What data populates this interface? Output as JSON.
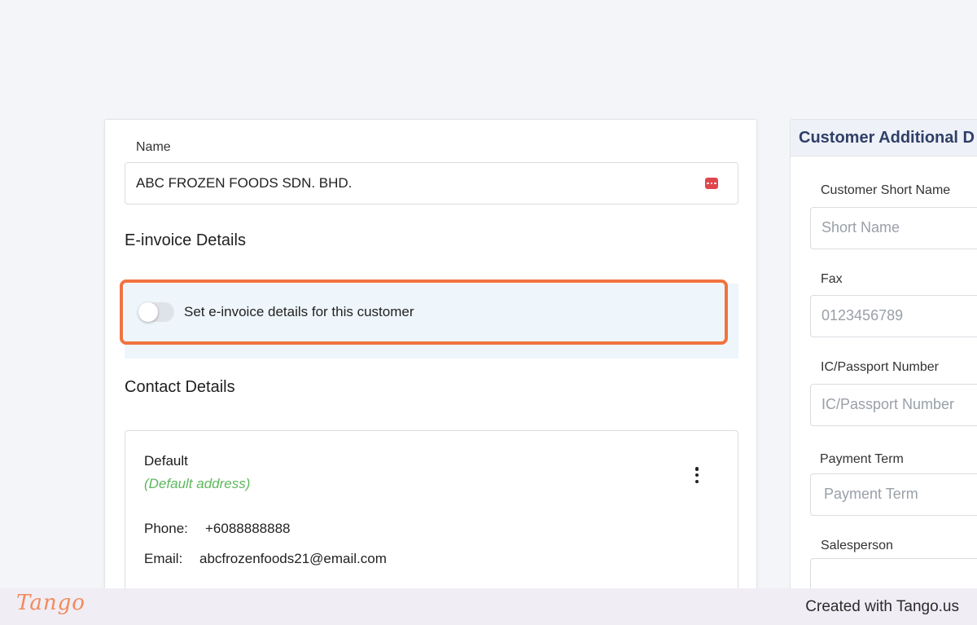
{
  "customer": {
    "name_label": "Name",
    "name_value": "ABC FROZEN FOODS SDN. BHD."
  },
  "einvoice": {
    "title": "E-invoice Details",
    "toggle_label": "Set e-invoice details for this customer",
    "toggle_on": false
  },
  "contact": {
    "title": "Contact Details",
    "address": {
      "name": "Default",
      "default_tag": "(Default address)",
      "phone_label": "Phone:",
      "phone_value": "+6088888888",
      "email_label": "Email:",
      "email_value": "abcfrozenfoods21@email.com"
    }
  },
  "additional": {
    "header": "Customer Additional D",
    "fields": [
      {
        "label": "Customer Short Name",
        "placeholder": "Short Name"
      },
      {
        "label": "Fax",
        "placeholder": "0123456789"
      },
      {
        "label": "IC/Passport Number",
        "placeholder": "IC/Passport Number"
      },
      {
        "label": "Payment Term",
        "placeholder": "Payment Term"
      },
      {
        "label": "Salesperson",
        "placeholder": ""
      }
    ]
  },
  "footer": {
    "logo": "Tango",
    "credit": "Created with Tango.us"
  },
  "colors": {
    "highlight": "#f1733f",
    "default_tag": "#5cb85c",
    "header_text": "#2f3f68",
    "brand": "#f28a5a"
  }
}
